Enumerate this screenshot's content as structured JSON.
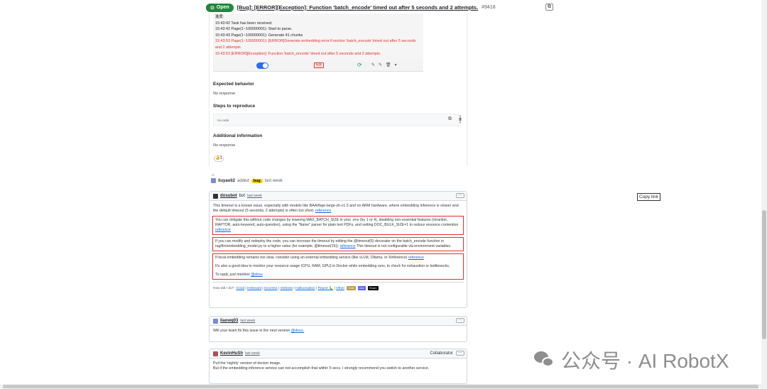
{
  "header": {
    "status": "Open",
    "title": "[Bug]: [ERROR][Exception]: Function 'batch_encode' timed out after 5 seconds and 2 attempts.",
    "number": "#9418"
  },
  "log": {
    "heading": "進度:",
    "lines": [
      {
        "text": "15:43:42 Task has been received.",
        "red": false
      },
      {
        "text": "15:43:42 Page(1~100000001): Start to parse.",
        "red": false
      },
      {
        "text": "15:43:43 Page(1~100000001): Generate 41 chunks",
        "red": false
      },
      {
        "text": "15:43:53 Page(1~100000001): [ERROR]Generate embedding error:Function 'batch_encode' timed out after 5 seconds and 2 attempts.",
        "red": true
      },
      {
        "text": "15:43:53 [ERROR][Exception]: Function 'batch_encode' timed out after 5 seconds and 2 attempts.",
        "red": true
      }
    ],
    "tag": "失败"
  },
  "sections": {
    "expected_title": "Expected behavior",
    "expected_text": "No response",
    "steps_title": "Steps to reproduce",
    "steps_code": "no-code",
    "additional_title": "Additional information",
    "additional_text": "No response",
    "reaction": "👍1"
  },
  "event": {
    "user": "liuyaoli2",
    "action": "added",
    "label": "bug",
    "time": "last week"
  },
  "bot_comment": {
    "author": "dosubot",
    "role": "bot",
    "time": "last week",
    "p1": "This timeout is a known issue, especially with models like BAAI/bge-large-zh-v1.5 and on ARM hardware, where embedding inference is slower and the default timeout (5 seconds, 2 attempts) is often too short.",
    "p1_link": "reference",
    "p2": "You can mitigate this without code changes by lowering MAX_BATCH_SIZE in your .env (try 1 or 4), disabling non-essential features (reranker, RAPTOR, auto-keyword, auto-question), using the \"Naive\" parser for plain text PDFs, and setting DOC_BULK_SIZE=1 to reduce resource contention",
    "p2_link": "reference",
    "p3": "If you can modify and redeploy the code, you can increase the timeout by editing the @timeout(5) decorator on the batch_encode function in rag/llm/embedding_model.py to a higher value (for example, @timeout(15)).",
    "p3_link": "reference",
    "p3_tail": "This timeout is not configurable via environment variables.",
    "p4": "If local embedding remains too slow, consider using an external embedding service (like vLLM, Ollama, or Xinference)",
    "p4_link": "reference",
    "p5": "It's also a good idea to monitor your resource usage (CPU, RAM, GPU) in Docker while embedding runs, to check for exhaustion or bottlenecks.",
    "p6": "To reply, just mention",
    "p6_link": "@dosu",
    "helpful_prompt": "How did I do?",
    "feedback": [
      "Good",
      "Irrelevant",
      "Incorrect",
      "Verbose",
      "Hallucination",
      "Report 🐛",
      "Other"
    ],
    "pills": [
      "Chat",
      "Join",
      "Share"
    ]
  },
  "comment2": {
    "author": "liaowq03",
    "time": "last week",
    "text": "Will your team fix this issue in the next version",
    "mention": "@dosu."
  },
  "comment3": {
    "author": "KevinHuSh",
    "time": "last week",
    "badge": "Collaborator",
    "line1": "Pull the 'nightly' version of docker image.",
    "line2": "But if the embedding inference service can not accomplish that within 5 secs, I strongly recommend you switch to another service."
  },
  "tooltip": "Copy link",
  "watermark": "公众号 · AI RobotX"
}
